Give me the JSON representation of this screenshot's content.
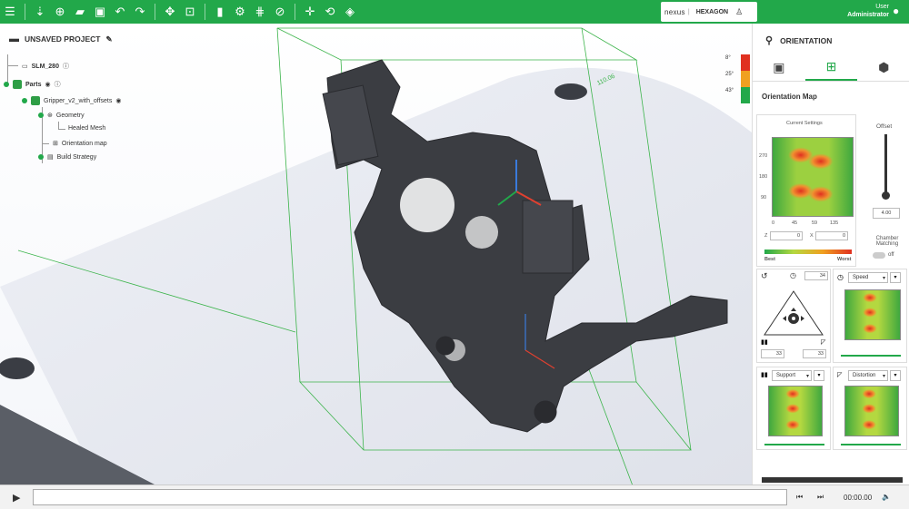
{
  "toolbar": {
    "icons": [
      "menu-icon",
      "add-part-icon",
      "add-icon",
      "open-folder-icon",
      "save-icon",
      "undo-icon",
      "redo-icon",
      "move-icon",
      "fit-view-icon",
      "box-view-icon",
      "orientation-icon",
      "support-icon",
      "compass-icon",
      "translate-icon",
      "rotate-icon",
      "layers-icon"
    ],
    "brand_left": "nexus",
    "brand_right": "HEXAGON",
    "user_label": "User",
    "user_name": "Administrator"
  },
  "project": {
    "title": "UNSAVED PROJECT",
    "machine": "SLM_280",
    "parts_label": "Parts",
    "part_name": "Gripper_v2_with_offsets",
    "geometry": "Geometry",
    "healed_mesh": "Healed Mesh",
    "orientation_map": "Orientation map",
    "build_strategy": "Build Strategy"
  },
  "viewport": {
    "dimension_label": "110.06",
    "overhang_angles": [
      "8°",
      "25°",
      "43°"
    ],
    "legend_colors": [
      "#e03020",
      "#f0a020",
      "#22a84a"
    ]
  },
  "panel": {
    "title": "ORIENTATION",
    "tab_icons": [
      "toolbox-icon",
      "orientation-map-icon",
      "cube-settings-icon"
    ],
    "section_title": "Orientation Map",
    "current_settings": "Current Settings",
    "offset_label": "Offset",
    "offset_value": "4.00",
    "y_ticks": [
      "270",
      "180",
      "90"
    ],
    "x_ticks": [
      "0",
      "45",
      "59",
      "135"
    ],
    "z_label": "Z",
    "z_value": "0",
    "x_label": "X",
    "x_value": "0",
    "chamber_matching": "Chamber Matching",
    "toggle_label": "off",
    "best_label": "Best",
    "worst_label": "Worst",
    "triangle_top_value": "34",
    "triangle_left_value": "33",
    "triangle_right_value": "33",
    "speed_select": "Speed",
    "support_select": "Support",
    "distortion_select": "Distortion"
  },
  "player": {
    "time": "00:00.00"
  }
}
